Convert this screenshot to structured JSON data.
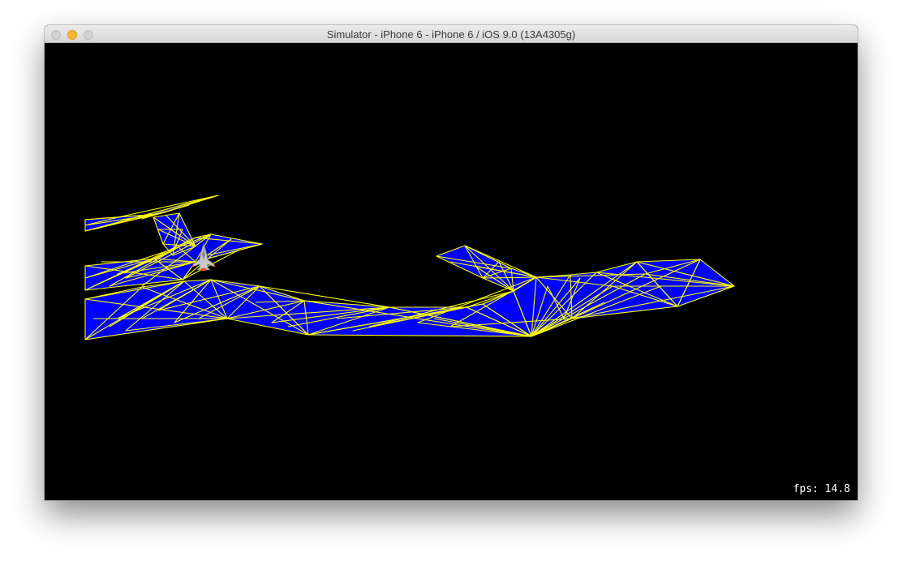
{
  "window": {
    "title": "Simulator - iPhone 6 - iPhone 6 / iOS 9.0 (13A4305g)"
  },
  "scene": {
    "fps_label": "fps: 14.8",
    "mesh_fill_color": "#0000ff",
    "wireframe_color": "#ffff00",
    "background_color": "#000000"
  },
  "icons": {
    "player": "spaceship-icon"
  }
}
